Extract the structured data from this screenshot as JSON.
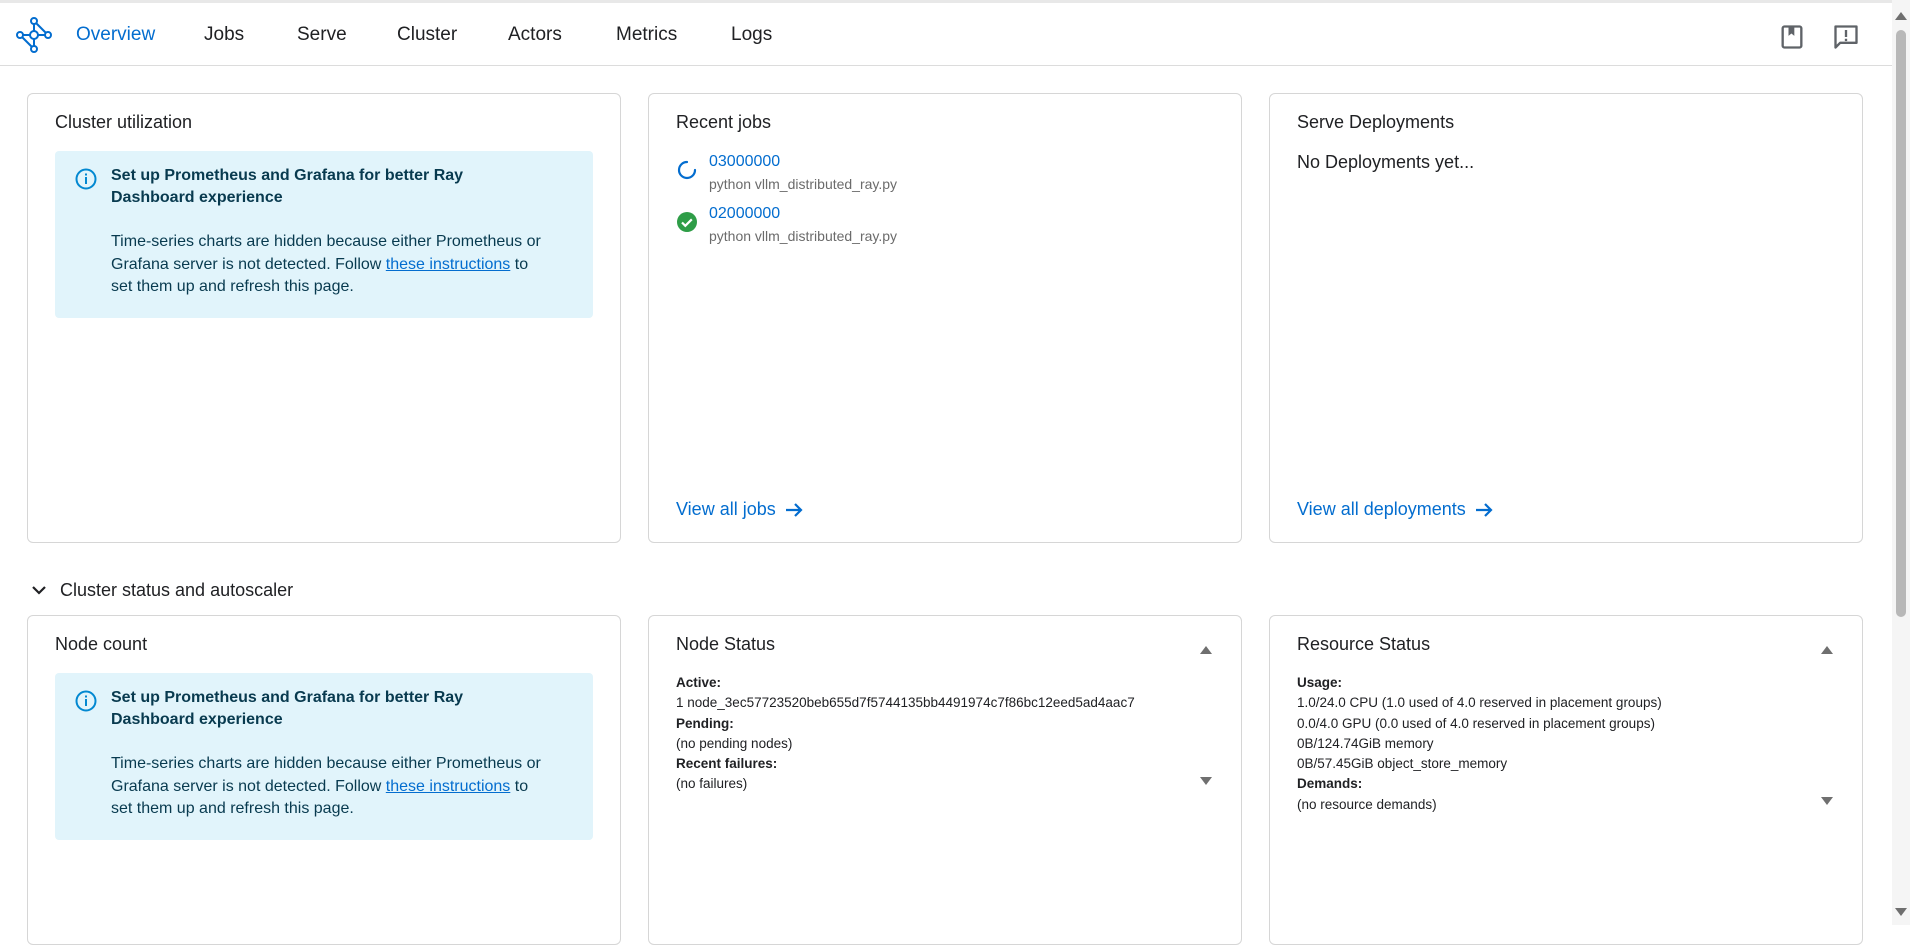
{
  "nav": {
    "tabs": [
      "Overview",
      "Jobs",
      "Serve",
      "Cluster",
      "Actors",
      "Metrics",
      "Logs"
    ],
    "active": "Overview",
    "right_icons": [
      "docs-book-icon",
      "feedback-icon"
    ]
  },
  "cluster_utilization": {
    "title": "Cluster utilization",
    "info_title": "Set up Prometheus and Grafana for better Ray Dashboard experience",
    "info_body_1": "Time-series charts are hidden because either Prometheus or Grafana server is not detected. Follow ",
    "info_link": "these instructions",
    "info_body_2": " to set them up and refresh this page."
  },
  "recent_jobs": {
    "title": "Recent jobs",
    "jobs": [
      {
        "id": "03000000",
        "command": "python vllm_distributed_ray.py",
        "status": "running"
      },
      {
        "id": "02000000",
        "command": "python vllm_distributed_ray.py",
        "status": "succeeded"
      }
    ],
    "view_all": "View all jobs"
  },
  "serve": {
    "title": "Serve Deployments",
    "empty": "No Deployments yet...",
    "view_all": "View all deployments"
  },
  "section": {
    "label": "Cluster status and autoscaler"
  },
  "node_count": {
    "title": "Node count",
    "info_title": "Set up Prometheus and Grafana for better Ray Dashboard experience",
    "info_body_1": "Time-series charts are hidden because either Prometheus or Grafana server is not detected. Follow ",
    "info_link": "these instructions",
    "info_body_2": " to set them up and refresh this page."
  },
  "node_status": {
    "title": "Node Status",
    "active_label": "Active:",
    "active_value": "1 node_3ec57723520beb655d7f5744135bb4491974c7f86bc12eed5ad4aac7",
    "pending_label": "Pending:",
    "pending_value": "(no pending nodes)",
    "failures_label": "Recent failures:",
    "failures_value": "(no failures)"
  },
  "resource_status": {
    "title": "Resource Status",
    "usage_label": "Usage:",
    "usage_lines": [
      "1.0/24.0 CPU (1.0 used of 4.0 reserved in placement groups)",
      "0.0/4.0 GPU (0.0 used of 4.0 reserved in placement groups)",
      "0B/124.74GiB memory",
      "0B/57.45GiB object_store_memory"
    ],
    "demands_label": "Demands:",
    "demands_value": "(no resource demands)"
  },
  "colors": {
    "accent": "#036dcf",
    "info_bg": "#e1f4fb",
    "success": "#2e9d47"
  }
}
